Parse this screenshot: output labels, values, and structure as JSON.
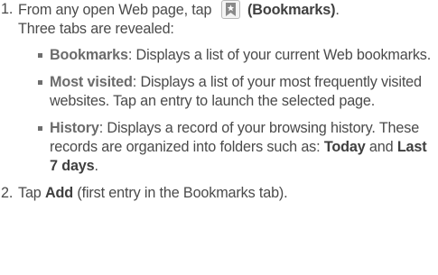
{
  "step1": {
    "number": "1.",
    "text_before_icon": "From any open Web page, tap",
    "icon": "bookmark-star-icon",
    "icon_label": "(Bookmarks)",
    "text_after_icon": ".",
    "line2": "Three tabs are revealed:"
  },
  "bullets": [
    {
      "term": "Bookmarks",
      "description": ": Displays a list of your current Web bookmarks."
    },
    {
      "term": "Most visited",
      "description": ": Displays a list of your most frequently visited websites. Tap an entry to launch the selected page."
    },
    {
      "term": "History",
      "description_before": ": Displays a record of your browsing history. These records are organized into folders such as: ",
      "kw1": "Today",
      "middle": " and ",
      "kw2": "Last 7 days",
      "description_after": "."
    }
  ],
  "step2": {
    "number": "2.",
    "text_before": "Tap ",
    "keyword": "Add",
    "text_after": " (first entry in the Bookmarks tab)."
  },
  "colors": {
    "text": "#4a4a4a",
    "bold_term": "#6b6b6b",
    "icon_border": "#b9b9b9"
  }
}
